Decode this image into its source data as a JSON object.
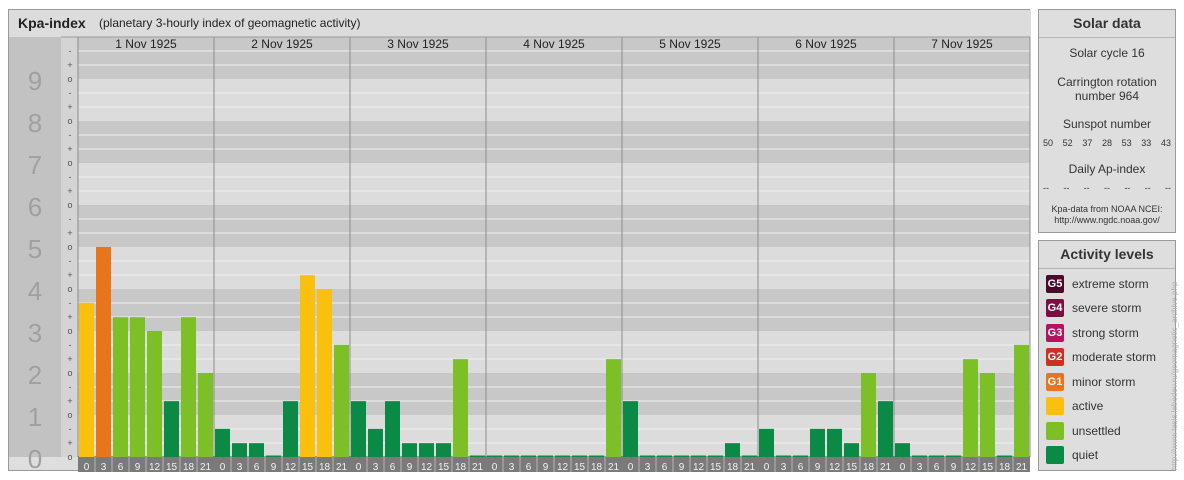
{
  "header": {
    "title": "Kpa-index",
    "subtitle": "(planetary 3-hourly index of geomagnetic activity)"
  },
  "solar": {
    "heading": "Solar data",
    "cycle": "Solar cycle 16",
    "carrington_line1": "Carrington rotation",
    "carrington_line2": "number 964",
    "sunspot_label": "Sunspot number",
    "sunspots": [
      "50",
      "52",
      "37",
      "28",
      "53",
      "33",
      "43"
    ],
    "ap_label": "Daily Ap-index",
    "ap_values": [
      "--",
      "--",
      "--",
      "--",
      "--",
      "--",
      "--"
    ],
    "source_line1": "Kpa-data from NOAA NCEI:",
    "source_line2": "http://www.ngdc.noaa.gov/"
  },
  "activity": {
    "heading": "Activity levels",
    "levels": [
      {
        "badge": "G5",
        "label": "extreme storm",
        "color": "#4a0a2a"
      },
      {
        "badge": "G4",
        "label": "severe storm",
        "color": "#7a1040"
      },
      {
        "badge": "G3",
        "label": "strong storm",
        "color": "#b01660"
      },
      {
        "badge": "G2",
        "label": "moderate storm",
        "color": "#cc2f24"
      },
      {
        "badge": "G1",
        "label": "minor storm",
        "color": "#e8741c"
      },
      {
        "badge": "",
        "label": "active",
        "color": "#f9c10e"
      },
      {
        "badge": "",
        "label": "unsettled",
        "color": "#7cbf26"
      },
      {
        "badge": "",
        "label": "quiet",
        "color": "#0a8a45"
      }
    ]
  },
  "credit": "http://www.tesis.lebedev.ru/geomagnetic_archive.php",
  "chart_data": {
    "type": "bar",
    "ylim": [
      0,
      9
    ],
    "y_ticks": [
      "0",
      "1",
      "2",
      "3",
      "4",
      "5",
      "6",
      "7",
      "8",
      "9"
    ],
    "minor_tick_labels": [
      "o",
      "+",
      "-"
    ],
    "days": [
      "1 Nov 1925",
      "2 Nov 1925",
      "3 Nov 1925",
      "4 Nov 1925",
      "5 Nov 1925",
      "6 Nov 1925",
      "7 Nov 1925"
    ],
    "interval_start": [
      "0",
      "3",
      "6",
      "9",
      "12",
      "15",
      "18",
      "21"
    ],
    "interval_end": [
      "3",
      "6",
      "9",
      "12",
      "15",
      "18",
      "21",
      "24"
    ],
    "values": [
      [
        3.67,
        5.0,
        3.33,
        3.33,
        3.0,
        1.33,
        3.33,
        2.0
      ],
      [
        0.67,
        0.33,
        0.33,
        0.0,
        1.33,
        4.33,
        4.0,
        2.67
      ],
      [
        1.33,
        0.67,
        1.33,
        0.33,
        0.33,
        0.33,
        2.33,
        0.0
      ],
      [
        0.0,
        0.0,
        0.0,
        0.0,
        0.0,
        0.0,
        0.0,
        2.33
      ],
      [
        1.33,
        0.0,
        0.0,
        0.0,
        0.0,
        0.0,
        0.33,
        0.0
      ],
      [
        0.67,
        0.0,
        0.0,
        0.67,
        0.67,
        0.33,
        2.0,
        1.33
      ],
      [
        0.33,
        0.0,
        0.0,
        0.0,
        2.33,
        2.0,
        0.0,
        2.67
      ]
    ],
    "colors": {
      "quiet": "#0a8a45",
      "unsettled": "#7cbf26",
      "active": "#f9c10e",
      "minor_storm": "#e8741c"
    }
  }
}
